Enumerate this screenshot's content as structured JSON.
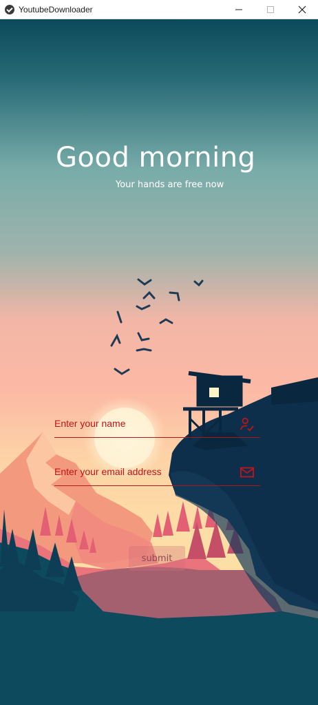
{
  "window": {
    "title": "YoutubeDownloader",
    "controls": [
      "minimize",
      "maximize",
      "close"
    ]
  },
  "greeting": {
    "title": "Good morning",
    "subtitle": "Your hands are free now"
  },
  "form": {
    "name_placeholder": "Enter your name",
    "name_icon": "user-check-icon",
    "email_placeholder": "Enter your email address",
    "email_icon": "envelope-icon",
    "submit_label": "submit"
  },
  "colors": {
    "accent": "#c0141a",
    "sky_top": "#0b4a5a",
    "sky_bottom": "#fdd9a0",
    "ground": "#0c4a5c"
  }
}
